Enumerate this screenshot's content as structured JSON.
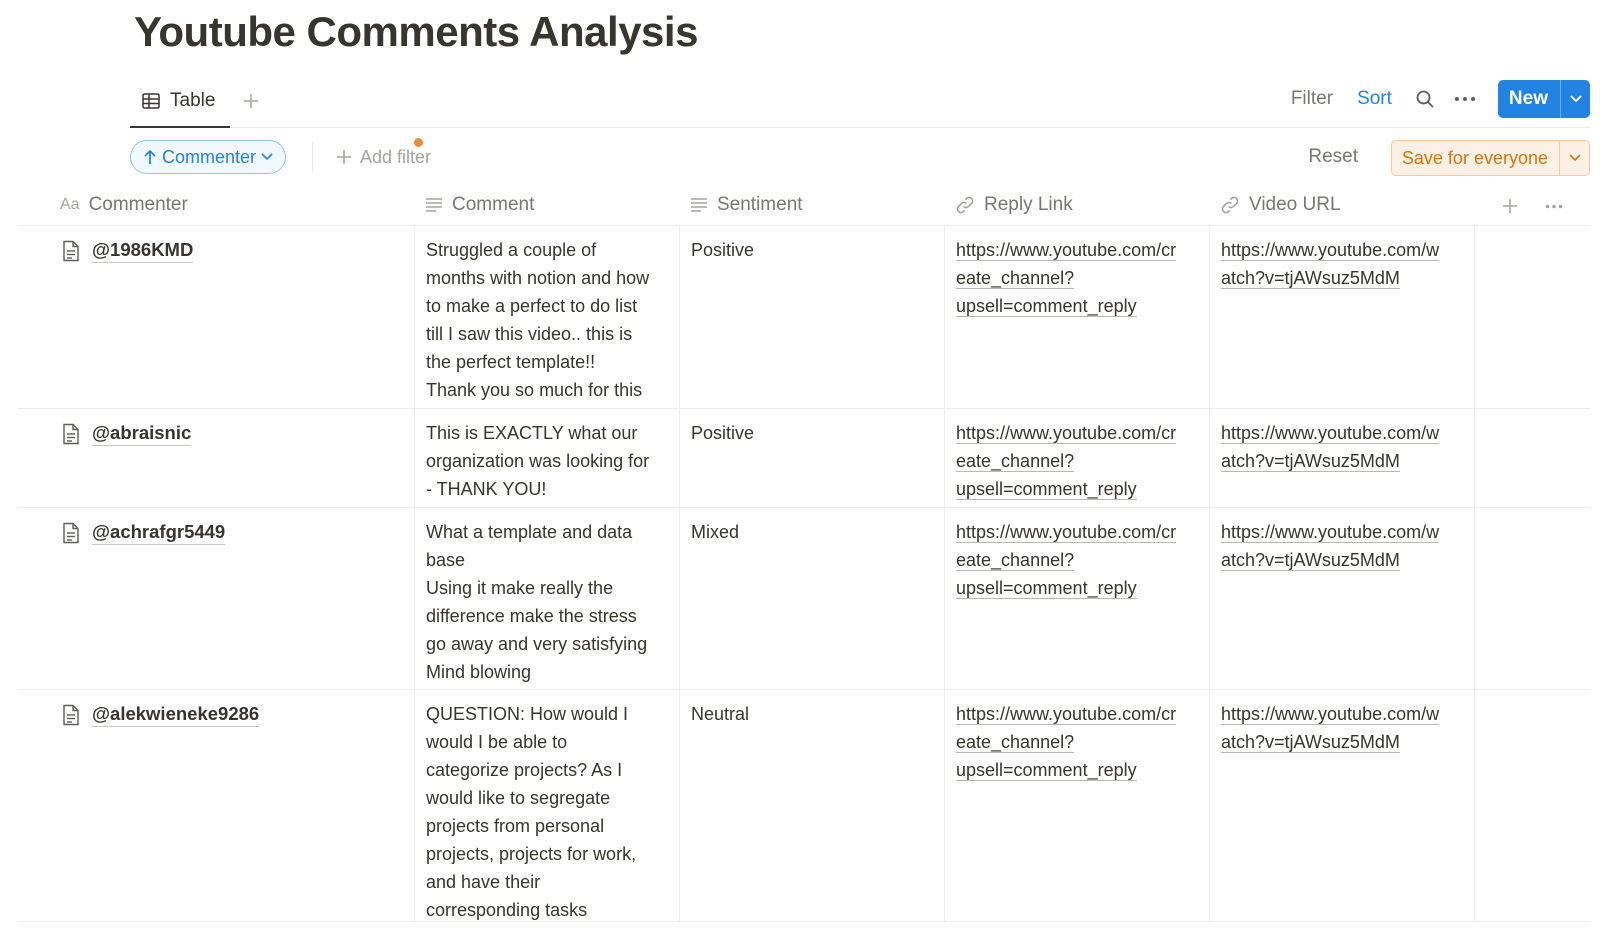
{
  "page": {
    "title": "Youtube Comments Analysis"
  },
  "views": {
    "active_tab": {
      "label": "Table",
      "icon": "table-icon"
    },
    "add_view_icon": "plus-icon"
  },
  "toolbar": {
    "filter_label": "Filter",
    "sort_label": "Sort",
    "search_icon": "search-icon",
    "more_icon": "more-horizontal-icon",
    "new_label": "New"
  },
  "filters": {
    "sort_chip_label": "Commenter",
    "add_filter_label": "Add filter",
    "reset_label": "Reset",
    "save_label": "Save for everyone"
  },
  "colors": {
    "accent": "#2383e2",
    "save": "#d9730d",
    "unsaved_dot": "#f0883e"
  },
  "table": {
    "columns": [
      {
        "label": "Commenter",
        "icon": "title-aa-icon"
      },
      {
        "label": "Comment",
        "icon": "text-lines-icon"
      },
      {
        "label": "Sentiment",
        "icon": "text-lines-icon"
      },
      {
        "label": "Reply Link",
        "icon": "link-icon"
      },
      {
        "label": "Video URL",
        "icon": "link-icon"
      }
    ],
    "rows": [
      {
        "commenter": "@1986KMD",
        "comment": "Struggled a couple of\nmonths with notion and how\nto make a perfect to do list\ntill I saw this video.. this is\nthe perfect template!!\nThank you so much for this",
        "sentiment": "Positive",
        "reply_link": [
          "https://www.youtube.com/cr",
          "eate_channel?",
          "upsell=comment_reply"
        ],
        "video_url": [
          "https://www.youtube.com/w",
          "atch?v=tjAWsuz5MdM"
        ]
      },
      {
        "commenter": "@abraisnic",
        "comment": "This is EXACTLY what our\norganization was looking for\n- THANK YOU!",
        "sentiment": "Positive",
        "reply_link": [
          "https://www.youtube.com/cr",
          "eate_channel?",
          "upsell=comment_reply"
        ],
        "video_url": [
          "https://www.youtube.com/w",
          "atch?v=tjAWsuz5MdM"
        ]
      },
      {
        "commenter": "@achrafgr5449",
        "comment": "What a template and data\nbase\nUsing it make really the\ndifference make the stress\ngo away and very satisfying\nMind blowing",
        "sentiment": "Mixed",
        "reply_link": [
          "https://www.youtube.com/cr",
          "eate_channel?",
          "upsell=comment_reply"
        ],
        "video_url": [
          "https://www.youtube.com/w",
          "atch?v=tjAWsuz5MdM"
        ]
      },
      {
        "commenter": "@alekwieneke9286",
        "comment": "QUESTION: How would I\nwould I be able to\ncategorize projects? As I\nwould like to segregate\nprojects from personal\nprojects, projects for work,\nand have their\ncorresponding tasks",
        "sentiment": "Neutral",
        "reply_link": [
          "https://www.youtube.com/cr",
          "eate_channel?",
          "upsell=comment_reply"
        ],
        "video_url": [
          "https://www.youtube.com/w",
          "atch?v=tjAWsuz5MdM"
        ]
      }
    ]
  }
}
